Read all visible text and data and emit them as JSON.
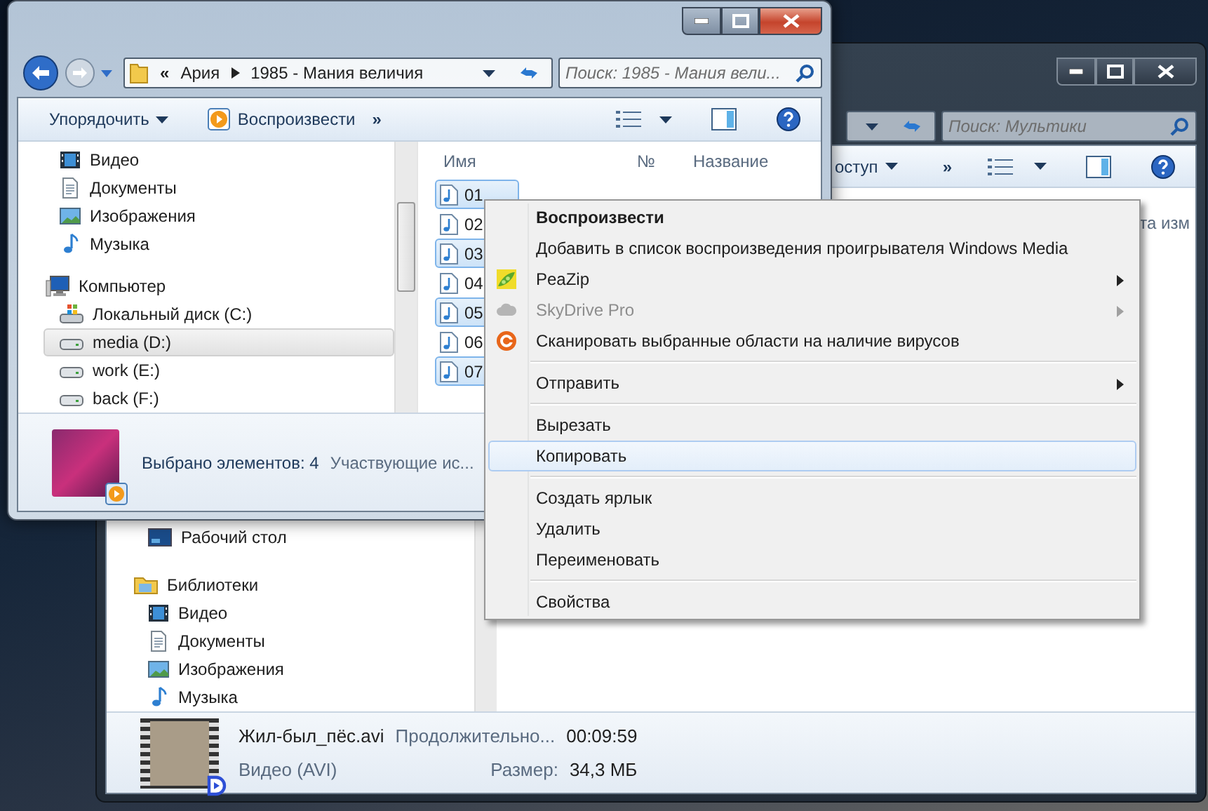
{
  "back_window": {
    "search": {
      "placeholder": "Поиск: Мультики"
    },
    "toolbar": {
      "partial_item": "оступ",
      "more": "»"
    },
    "column_header": "та изм",
    "nav": [
      {
        "label": "Рабочий стол",
        "selected": false
      },
      {
        "label": "Библиотеки",
        "selected": false,
        "children": [
          {
            "label": "Видео",
            "selected": false
          },
          {
            "label": "Документы",
            "selected": false
          },
          {
            "label": "Изображения",
            "selected": false
          },
          {
            "label": "Музыка",
            "selected": false
          }
        ]
      }
    ],
    "details": {
      "name": "Жил-был_пёс.avi",
      "type": "Видео (AVI)",
      "fields": [
        {
          "label": "Продолжительно...",
          "value": "00:09:59"
        },
        {
          "label": "Размер:",
          "value": "34,3 МБ"
        }
      ]
    }
  },
  "front_window": {
    "address": {
      "overflow": "«",
      "segments": [
        "Ария",
        "1985 - Мания величия"
      ]
    },
    "search": {
      "placeholder": "Поиск: 1985 - Мания вели..."
    },
    "toolbar": {
      "organize": "Упорядочить",
      "play": "Воспроизвести",
      "more": "»"
    },
    "nav": [
      {
        "label": "Видео",
        "selected": false
      },
      {
        "label": "Документы",
        "selected": false
      },
      {
        "label": "Изображения",
        "selected": false
      },
      {
        "label": "Музыка",
        "selected": false
      },
      {
        "label": "Компьютер",
        "selected": false,
        "children": [
          {
            "label": "Локальный диск (C:)",
            "selected": false
          },
          {
            "label": "media (D:)",
            "selected": true
          },
          {
            "label": "work (E:)",
            "selected": false
          },
          {
            "label": "back (F:)",
            "selected": false
          }
        ]
      }
    ],
    "columns": [
      "Имя",
      "№",
      "Название"
    ],
    "files": [
      {
        "name": "01",
        "selected": true
      },
      {
        "name": "02",
        "selected": false
      },
      {
        "name": "03",
        "selected": true
      },
      {
        "name": "04",
        "selected": false
      },
      {
        "name": "05",
        "selected": true
      },
      {
        "name": "06",
        "selected": false
      },
      {
        "name": "07",
        "selected": true
      }
    ],
    "details": {
      "summary": "Выбрано элементов: 4",
      "contributors": "Участвующие ис..."
    }
  },
  "context_menu": [
    {
      "kind": "item",
      "label": "Воспроизвести",
      "default": true,
      "disabled": false,
      "submenu": false,
      "selected": false
    },
    {
      "kind": "item",
      "label": "Добавить в список воспроизведения проигрывателя Windows Media",
      "default": false,
      "disabled": false,
      "submenu": false,
      "selected": false
    },
    {
      "kind": "item",
      "label": "PeaZip",
      "default": false,
      "disabled": false,
      "submenu": true,
      "selected": false
    },
    {
      "kind": "item",
      "label": "SkyDrive Pro",
      "default": false,
      "disabled": true,
      "submenu": true,
      "selected": false
    },
    {
      "kind": "item",
      "label": "Сканировать выбранные области на наличие вирусов",
      "default": false,
      "disabled": false,
      "submenu": false,
      "selected": false
    },
    {
      "kind": "separator"
    },
    {
      "kind": "item",
      "label": "Отправить",
      "default": false,
      "disabled": false,
      "submenu": true,
      "selected": false
    },
    {
      "kind": "separator"
    },
    {
      "kind": "item",
      "label": "Вырезать",
      "default": false,
      "disabled": false,
      "submenu": false,
      "selected": false
    },
    {
      "kind": "item",
      "label": "Копировать",
      "default": false,
      "disabled": false,
      "submenu": false,
      "selected": true
    },
    {
      "kind": "separator"
    },
    {
      "kind": "item",
      "label": "Создать ярлык",
      "default": false,
      "disabled": false,
      "submenu": false,
      "selected": false
    },
    {
      "kind": "item",
      "label": "Удалить",
      "default": false,
      "disabled": false,
      "submenu": false,
      "selected": false
    },
    {
      "kind": "item",
      "label": "Переименовать",
      "default": false,
      "disabled": false,
      "submenu": false,
      "selected": false
    },
    {
      "kind": "separator"
    },
    {
      "kind": "item",
      "label": "Свойства",
      "default": false,
      "disabled": false,
      "submenu": false,
      "selected": false
    }
  ]
}
